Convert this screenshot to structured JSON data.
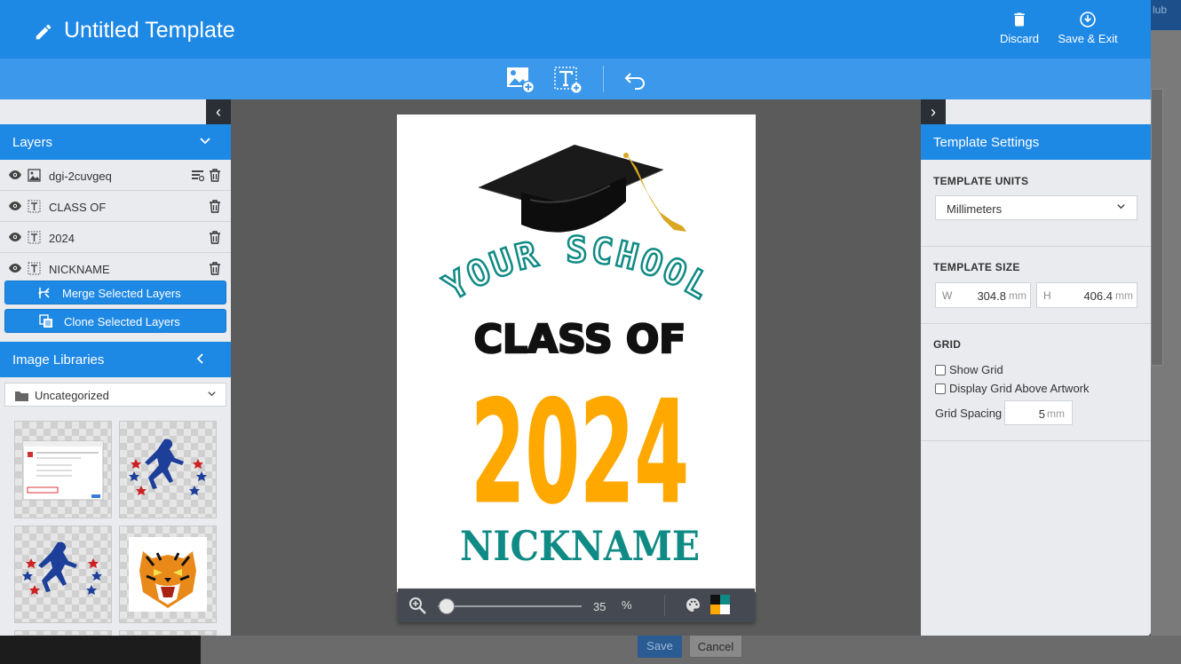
{
  "header": {
    "title": "Untitled Template",
    "discard_label": "Discard",
    "save_exit_label": "Save & Exit"
  },
  "toolbar": {
    "add_image_icon": "add-image-icon",
    "add_text_icon": "add-text-icon",
    "undo_icon": "undo-icon"
  },
  "layers": {
    "title": "Layers",
    "items": [
      {
        "name": "dgi-2cuvgeq",
        "type": "image"
      },
      {
        "name": "CLASS OF",
        "type": "text"
      },
      {
        "name": "2024",
        "type": "text"
      },
      {
        "name": "NICKNAME",
        "type": "text"
      }
    ],
    "merge_label": "Merge Selected Layers",
    "clone_label": "Clone Selected Layers"
  },
  "image_libraries": {
    "title": "Image Libraries",
    "folder": "Uncategorized"
  },
  "artwork": {
    "school": "YOUR SCHOOL",
    "class_of": "CLASS OF",
    "year": "2024",
    "nickname": "NICKNAME",
    "colors": {
      "teal": "#0f8a84",
      "gold": "#ffa800",
      "black": "#111111"
    }
  },
  "zoom": {
    "value": "35",
    "unit": "%",
    "level": 0.35
  },
  "template_settings": {
    "title": "Template Settings",
    "units_label": "TEMPLATE UNITS",
    "units_value": "Millimeters",
    "size_label": "TEMPLATE SIZE",
    "width_key": "W",
    "width_value": "304.8",
    "height_key": "H",
    "height_value": "406.4",
    "unit_abbr": "mm",
    "grid_label": "GRID",
    "show_grid_label": "Show Grid",
    "grid_above_label": "Display Grid Above Artwork",
    "spacing_label": "Grid Spacing",
    "spacing_value": "5"
  },
  "background": {
    "save_label": "Save",
    "cancel_label": "Cancel",
    "corner_text": "lub"
  }
}
